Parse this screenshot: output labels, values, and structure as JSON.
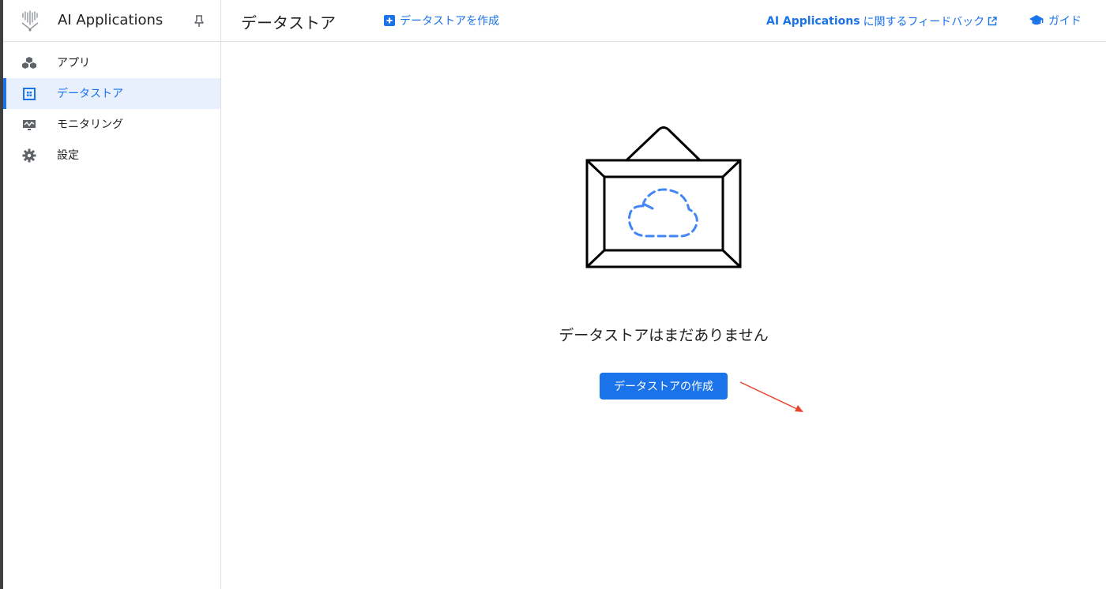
{
  "sidebar": {
    "product_name": "AI Applications",
    "items": [
      {
        "label": "アプリ",
        "icon": "cubes-icon"
      },
      {
        "label": "データストア",
        "icon": "datastore-icon"
      },
      {
        "label": "モニタリング",
        "icon": "monitoring-icon"
      },
      {
        "label": "設定",
        "icon": "gear-icon"
      }
    ],
    "active_index": 1
  },
  "header": {
    "page_title": "データストア",
    "create_link_label": "データストアを作成",
    "feedback": {
      "product": "AI Applications",
      "suffix": "に関するフィードバック"
    },
    "guide_label": "ガイド"
  },
  "main": {
    "empty_title": "データストアはまだありません",
    "create_button_label": "データストアの作成"
  },
  "colors": {
    "accent": "#1a73e8",
    "active_bg": "#e8f0fe",
    "annotation": "#e8452c"
  }
}
